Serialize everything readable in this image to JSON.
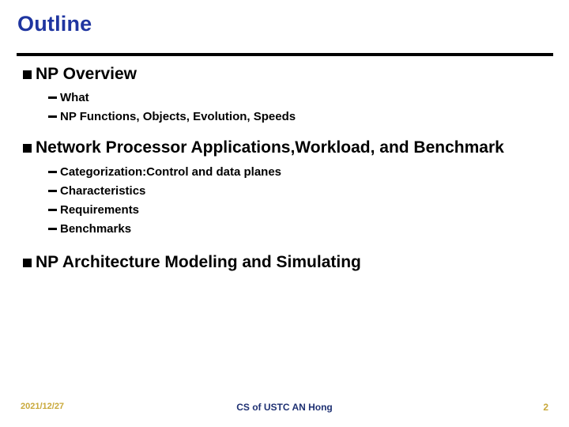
{
  "slide": {
    "title": "Outline",
    "title_color": "#1F35A0",
    "rule_color": "#000000",
    "background": "#ffffff",
    "bullets": [
      {
        "level1_bullet_icon": "filled-square-bullet",
        "text": "NP Overview",
        "sub": [
          {
            "bullet_icon": "dash-bullet",
            "text": "What"
          },
          {
            "bullet_icon": "dash-bullet",
            "text": "NP Functions, Objects, Evolution, Speeds"
          }
        ]
      },
      {
        "level1_bullet_icon": "filled-square-bullet",
        "text": "Network Processor Applications,Workload, and Benchmark",
        "sub": [
          {
            "bullet_icon": "dash-bullet",
            "text": "Categorization:Control and data planes"
          },
          {
            "bullet_icon": "dash-bullet",
            "text": "Characteristics"
          },
          {
            "bullet_icon": "dash-bullet",
            "text": "Requirements"
          },
          {
            "bullet_icon": "dash-bullet",
            "text": "Benchmarks"
          }
        ]
      },
      {
        "level1_bullet_icon": "filled-square-bullet",
        "text": "NP Architecture Modeling and Simulating",
        "sub": []
      }
    ]
  },
  "footer": {
    "date": "2021/12/27",
    "date_color": "#C9A93B",
    "center_text": "CS of USTC AN Hong",
    "center_color": "#1F3173",
    "page_number": "2",
    "page_number_color": "#C9A93B"
  }
}
